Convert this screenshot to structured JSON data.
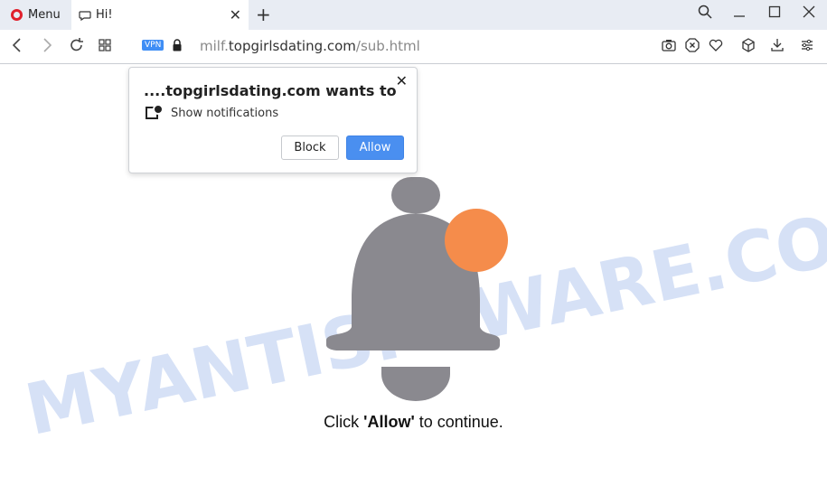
{
  "browser": {
    "menu_label": "Menu",
    "tab_title": "Hi!",
    "vpn_badge": "VPN",
    "url_prefix": "milf.",
    "url_host": "topgirlsdating.com",
    "url_path": "/sub.html"
  },
  "watermark": "MYANTISPYWARE.COM",
  "popup": {
    "title": "....topgirlsdating.com wants to",
    "subtitle": "Show notifications",
    "block_label": "Block",
    "allow_label": "Allow"
  },
  "page": {
    "cta_pre": "Click ",
    "cta_strong": "'Allow'",
    "cta_post": " to continue."
  },
  "colors": {
    "bell": "#8a898f",
    "badge": "#f58c4b",
    "allow_button": "#4a8ff0",
    "watermark": "#cfdcf5"
  },
  "icons": [
    "opera-logo-icon",
    "chat-icon",
    "close-icon",
    "plus-icon",
    "search-icon",
    "minimize-icon",
    "maximize-icon",
    "back-icon",
    "forward-icon",
    "reload-icon",
    "speed-dial-icon",
    "lock-icon",
    "camera-icon",
    "adblock-icon",
    "heart-icon",
    "cube-icon",
    "download-icon",
    "easy-setup-icon",
    "notification-icon",
    "bell-icon"
  ]
}
